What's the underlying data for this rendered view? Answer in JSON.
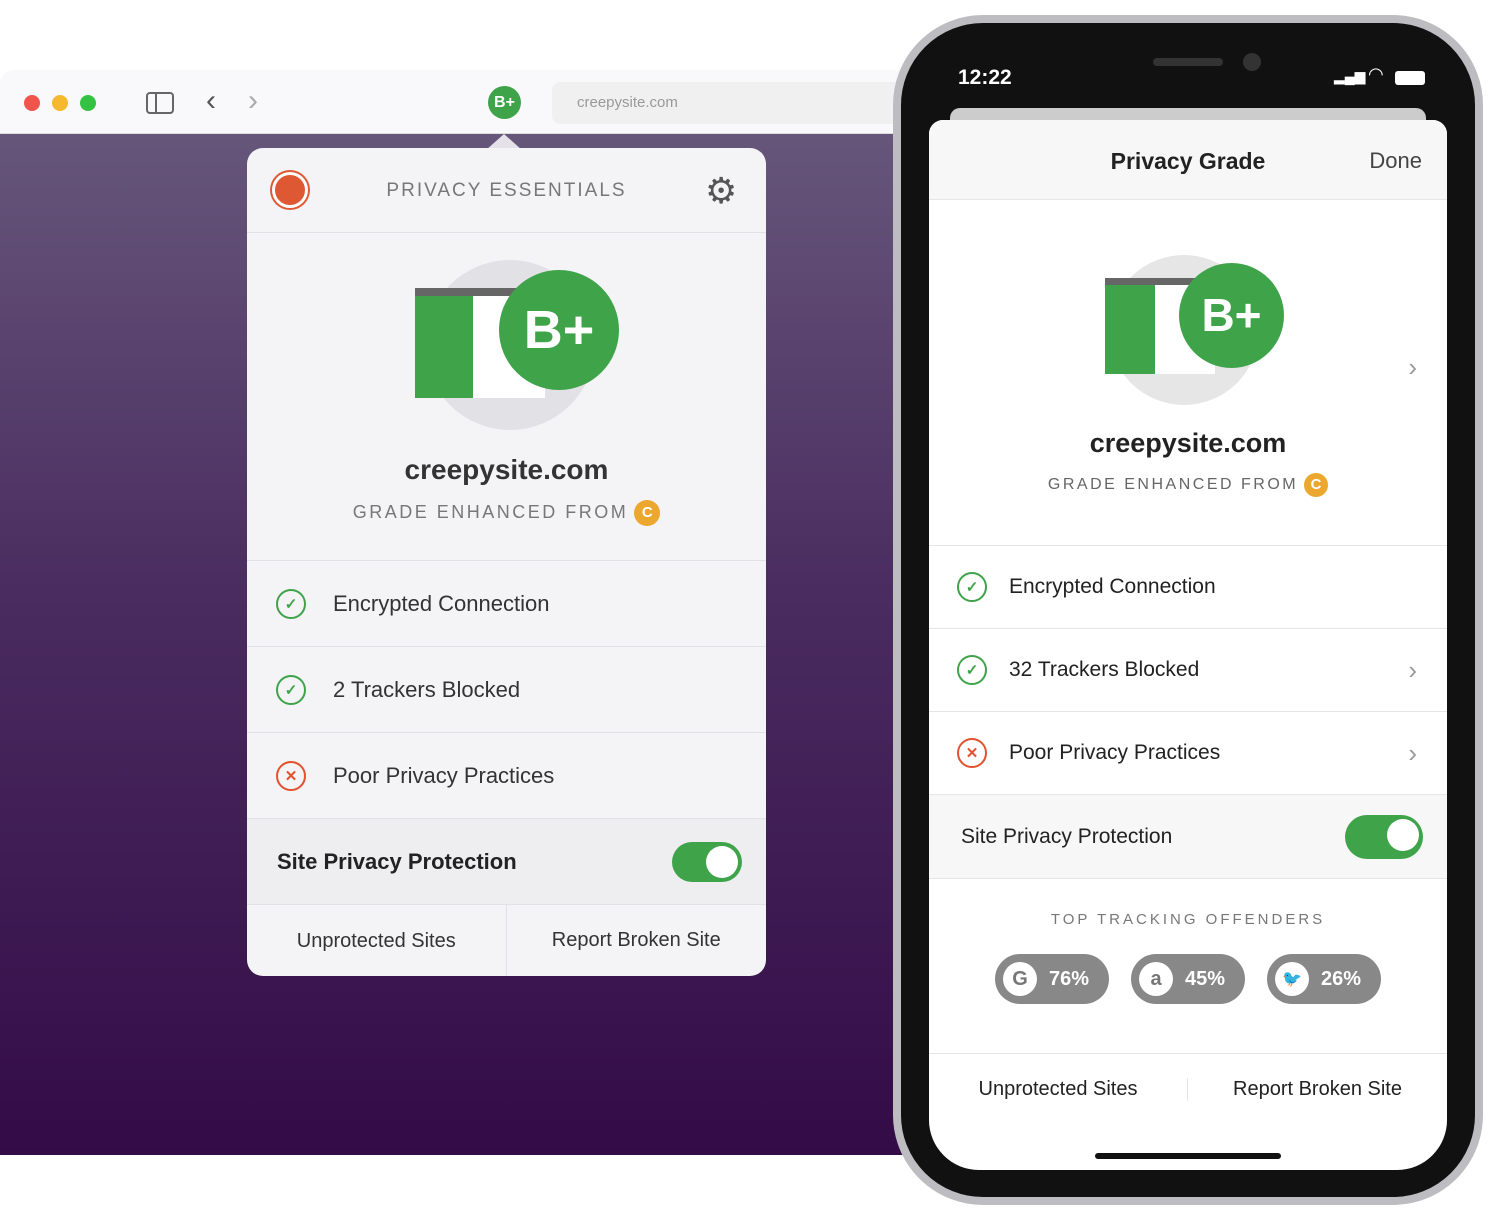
{
  "browser": {
    "url": "creepysite.com",
    "grade_badge": "B+"
  },
  "popup": {
    "title": "PRIVACY ESSENTIALS",
    "grade": "B+",
    "site": "creepysite.com",
    "enhanced_label": "GRADE ENHANCED FROM",
    "from_grade": "C",
    "items": [
      {
        "label": "Encrypted Connection",
        "status": "ok"
      },
      {
        "label": "2 Trackers Blocked",
        "status": "ok"
      },
      {
        "label": "Poor Privacy Practices",
        "status": "bad"
      }
    ],
    "protection_label": "Site Privacy Protection",
    "protection_on": true,
    "footer": [
      "Unprotected Sites",
      "Report Broken Site"
    ]
  },
  "phone": {
    "time": "12:22",
    "title": "Privacy Grade",
    "done": "Done",
    "grade": "B+",
    "site": "creepysite.com",
    "enhanced_label": "GRADE ENHANCED FROM",
    "from_grade": "C",
    "items": [
      {
        "label": "Encrypted Connection",
        "status": "ok"
      },
      {
        "label": "32 Trackers Blocked",
        "status": "ok"
      },
      {
        "label": "Poor Privacy Practices",
        "status": "bad"
      }
    ],
    "protection_label": "Site Privacy Protection",
    "protection_on": true,
    "offenders_title": "TOP TRACKING OFFENDERS",
    "offenders": [
      {
        "icon": "google-icon",
        "glyph": "G",
        "pct": "76%"
      },
      {
        "icon": "amazon-icon",
        "glyph": "a",
        "pct": "45%"
      },
      {
        "icon": "twitter-icon",
        "glyph": "🐦",
        "pct": "26%"
      }
    ],
    "footer": [
      "Unprotected Sites",
      "Report Broken Site"
    ]
  },
  "colors": {
    "green": "#3fa34a",
    "red": "#e2522e",
    "orange": "#eba72e",
    "purple": "#330b47"
  }
}
